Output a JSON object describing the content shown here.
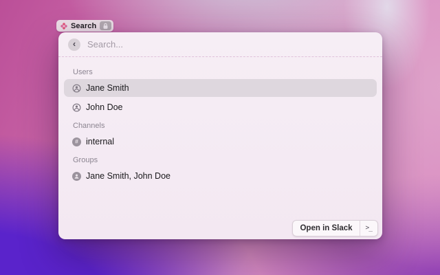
{
  "chip": {
    "icon": "flower-icon",
    "label": "Search",
    "badge_icon": "lock-icon"
  },
  "panel": {
    "search": {
      "back_glyph": "‹",
      "placeholder": "Search..."
    },
    "sections": [
      {
        "label": "Users",
        "items": [
          {
            "icon": "person-icon",
            "label": "Jane Smith",
            "selected": true
          },
          {
            "icon": "person-icon",
            "label": "John Doe",
            "selected": false
          }
        ]
      },
      {
        "label": "Channels",
        "items": [
          {
            "icon": "hash-icon",
            "icon_glyph": "#",
            "label": "internal",
            "selected": false
          }
        ]
      },
      {
        "label": "Groups",
        "items": [
          {
            "icon": "people-icon",
            "label": "Jane Smith, John Doe",
            "selected": false
          }
        ]
      }
    ],
    "footer": {
      "action_label": "Open in Slack",
      "shortcut_glyph": ">_"
    }
  },
  "colors": {
    "wallpaper_magenta": "#bb4f98",
    "wallpaper_pink": "#dfa3ca",
    "wallpaper_lavender": "#cbc9da",
    "wallpaper_violet": "#5a23cb",
    "wallpaper_purple": "#7c2cb1",
    "panel_bg": "#f4ebf3",
    "selection_bg": "#ded7de"
  }
}
